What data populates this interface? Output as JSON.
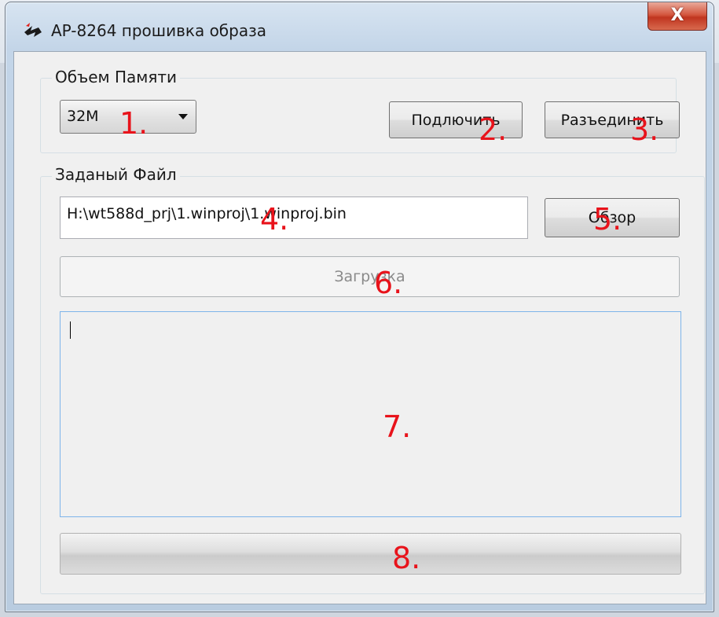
{
  "window": {
    "title": "AP-8264 прошивка образа",
    "close_glyph": "X"
  },
  "memory_group": {
    "label": "Объем Памяти",
    "size_select": {
      "value": "32M"
    },
    "connect_label": "Подлючить",
    "disconnect_label": "Разъединить"
  },
  "file_group": {
    "label": "Заданый Файл",
    "path_value": "H:\\wt588d_prj\\1.winproj\\1.winproj.bin",
    "browse_label": "Обзор",
    "upload_label": "Загрузка"
  },
  "log": {
    "text": ""
  },
  "progress": {
    "value": 0
  },
  "annotations": [
    "1.",
    "2.",
    "3.",
    "4.",
    "5.",
    "6.",
    "7.",
    "8."
  ],
  "icons": {
    "app": "app-logo-icon",
    "close": "close-icon",
    "dropdown": "chevron-down-icon"
  }
}
